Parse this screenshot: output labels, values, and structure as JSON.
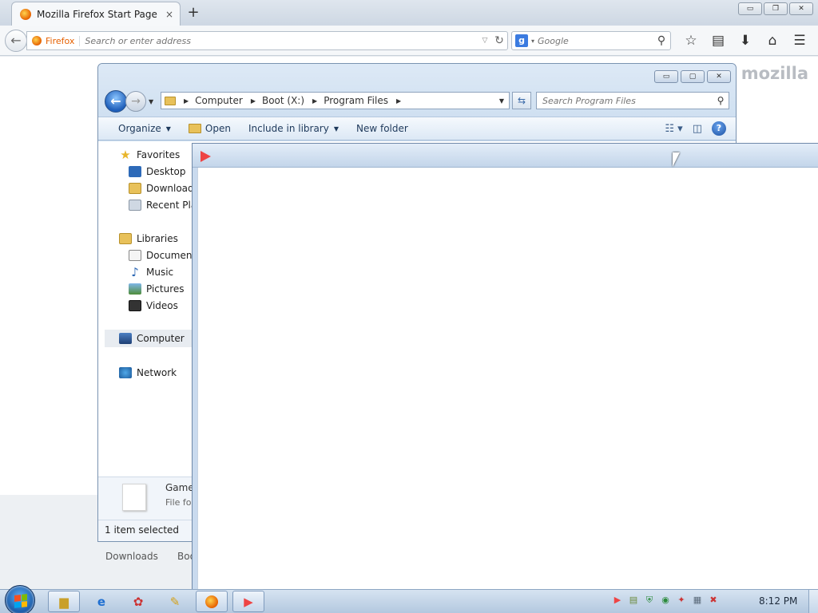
{
  "firefox": {
    "tab_title": "Mozilla Firefox Start Page",
    "tab_close": "×",
    "new_tab": "+",
    "identity_label": "Firefox",
    "url_placeholder": "Search or enter address",
    "search_engine": "Google",
    "search_placeholder": "Google",
    "brand_watermark": "mozilla",
    "bottom_items": [
      "Downloads",
      "Boo"
    ],
    "window_buttons": [
      "▭",
      "❐",
      "✕"
    ],
    "toolbar_icons": [
      "bookmark-star-icon",
      "reading-list-icon",
      "download-icon",
      "home-icon",
      "menu-icon"
    ]
  },
  "explorer": {
    "window_buttons": [
      "▭",
      "▢",
      "✕"
    ],
    "breadcrumbs": [
      "Computer",
      "Boot (X:)",
      "Program Files"
    ],
    "search_placeholder": "Search Program Files",
    "commands": {
      "organize": "Organize",
      "open": "Open",
      "include": "Include in library",
      "new_folder": "New folder"
    },
    "nav": {
      "favorites": "Favorites",
      "desktop": "Desktop",
      "downloads": "Downloads",
      "recent": "Recent Plac",
      "libraries": "Libraries",
      "documents": "Documents",
      "music": "Music",
      "pictures": "Pictures",
      "videos": "Videos",
      "computer": "Computer",
      "network": "Network"
    },
    "details": {
      "name": "Game",
      "type": "File fo"
    },
    "status": "1 item selected"
  },
  "taskbar": {
    "clock": "8:12 PM",
    "buttons": [
      "windows-explorer",
      "internet-explorer",
      "media-app",
      "paint-app",
      "firefox",
      "play-app"
    ],
    "colors": {
      "accent": "#1b5ba8",
      "taskbar": "#c4d6ea"
    }
  }
}
